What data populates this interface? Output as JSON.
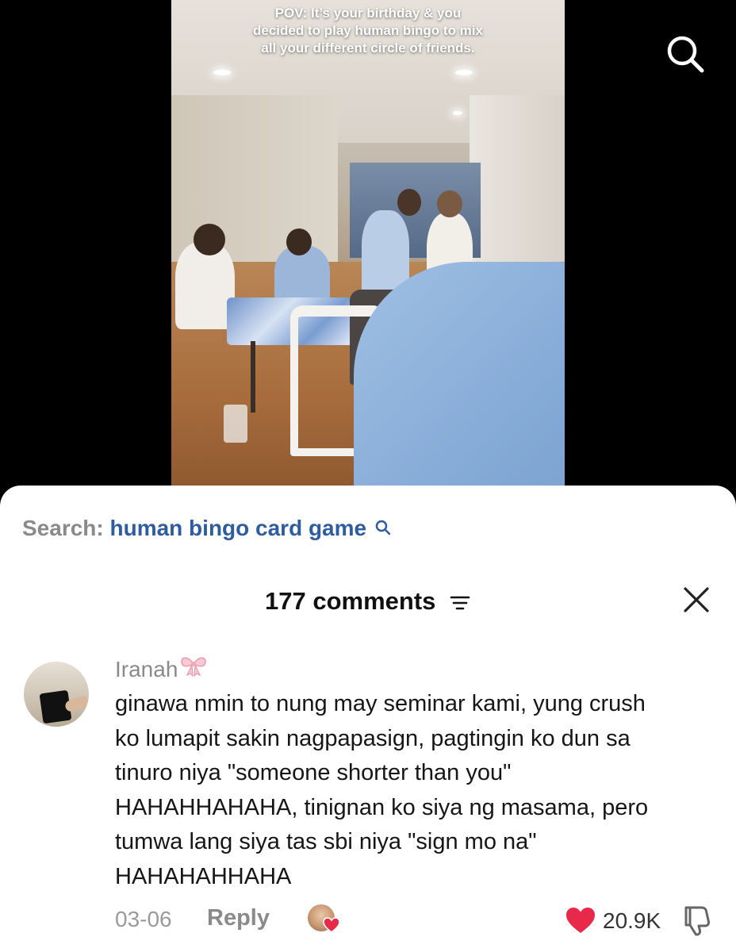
{
  "video": {
    "caption_lines": [
      "POV: It’s your birthday & you",
      "decided to play human bingo to mix",
      "all your different circle of friends."
    ]
  },
  "search_suggestion": {
    "prefix": "Search:",
    "term": "human bingo card game"
  },
  "comments": {
    "title": "177 comments",
    "items": [
      {
        "username": "Iranah",
        "username_icon": "ribbon-bow-icon",
        "text_lines": [
          "ginawa nmin to nung may seminar kami, yung crush",
          "ko lumapit sakin nagpapasign, pagtingin ko dun sa",
          "tinuro niya \"someone shorter than you\"",
          "HAHAHHAHAHA, tinignan ko siya ng masama, pero",
          "tumwa lang siya tas sbi niya \"sign mo na\"",
          "HAHAHAHHAHA"
        ],
        "date": "03-06",
        "reply_label": "Reply",
        "likes": "20.9K",
        "liked_by_creator": true
      }
    ]
  },
  "colors": {
    "search_term": "#2f5c9f",
    "like_heart": "#e8294a",
    "muted_text": "#8a8a8a"
  }
}
